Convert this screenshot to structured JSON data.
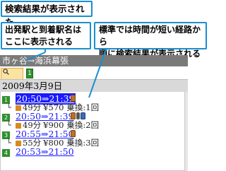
{
  "callouts": {
    "top": "検索結果が表示された",
    "left_line1": "出発駅と到着駅名は",
    "left_line2": "ここに表示される",
    "right_line1": "標準では時間が短い経路から",
    "right_line2": "順に検索結果が表示される"
  },
  "screen": {
    "route_title": "市ヶ谷→海浜幕張",
    "tabs": {
      "search_icon": "search-icon",
      "results_badge": "1"
    },
    "date": "2009年3月9日",
    "results": [
      {
        "number": "1",
        "time": "20:50⇒21:39",
        "modes": [
          "train"
        ],
        "duration": "49分",
        "fare": "¥570",
        "transfers": "乗換:1回",
        "selected": true
      },
      {
        "number": "2",
        "time": "20:50⇒21:39",
        "modes": [
          "train",
          "walk",
          "bus"
        ],
        "duration": "49分",
        "fare": "¥900",
        "transfers": "乗換:2回",
        "selected": false
      },
      {
        "number": "3",
        "time": "20:55⇒21:50",
        "modes": [
          "train"
        ],
        "duration": "55分",
        "fare": "¥800",
        "transfers": "乗換:3回",
        "selected": false
      },
      {
        "number": "4",
        "time": "20:53⇒21:50",
        "modes": [],
        "duration": "",
        "fare": "",
        "transfers": "",
        "selected": false
      }
    ]
  },
  "colors": {
    "callout_border": "#1a8fd0",
    "route_bar": "#7a7a7a",
    "date_bar": "#d9d9d9",
    "link": "#1a1aff",
    "badge_green": "#2f8f2f"
  }
}
